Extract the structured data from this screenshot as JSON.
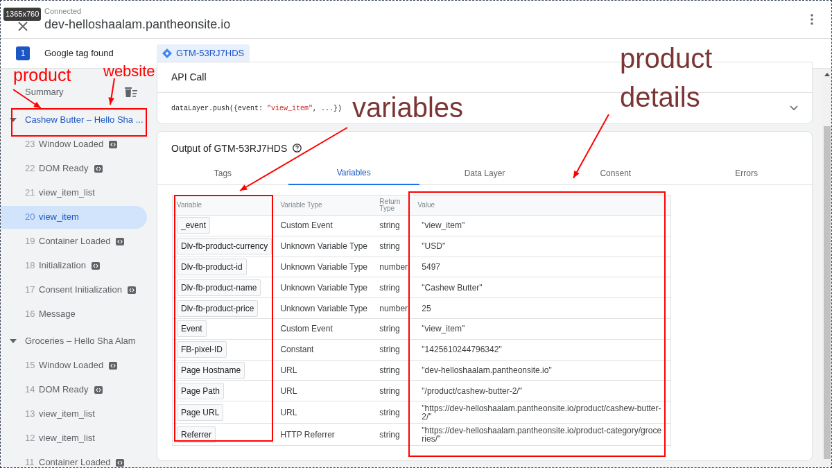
{
  "overlay_badge": "1365x760",
  "header": {
    "status": "Connected",
    "title": "dev-helloshaalam.pantheonsite.io"
  },
  "tag_bar": {
    "count": "1",
    "label": "Google tag found",
    "containers": [
      {
        "label": "GTM-53RJ7HDS",
        "selected": true
      }
    ]
  },
  "sidebar": {
    "summary": "Summary",
    "groups": [
      {
        "title": "Cashew Butter – Hello Sha ...",
        "expanded": true,
        "selected": true,
        "children": [
          {
            "number": "23",
            "name": "Window Loaded",
            "code_badge": true,
            "selected": false
          },
          {
            "number": "22",
            "name": "DOM Ready",
            "code_badge": true,
            "selected": false
          },
          {
            "number": "21",
            "name": "view_item_list",
            "code_badge": false,
            "selected": false
          },
          {
            "number": "20",
            "name": "view_item",
            "code_badge": false,
            "selected": true
          },
          {
            "number": "19",
            "name": "Container Loaded",
            "code_badge": true,
            "selected": false
          },
          {
            "number": "18",
            "name": "Initialization",
            "code_badge": true,
            "selected": false
          },
          {
            "number": "17",
            "name": "Consent Initialization",
            "code_badge": true,
            "selected": false
          },
          {
            "number": "16",
            "name": "Message",
            "code_badge": false,
            "selected": false
          }
        ]
      },
      {
        "title": "Groceries – Hello Sha Alam",
        "expanded": true,
        "selected": false,
        "children": [
          {
            "number": "15",
            "name": "Window Loaded",
            "code_badge": true,
            "selected": false
          },
          {
            "number": "14",
            "name": "DOM Ready",
            "code_badge": true,
            "selected": false
          },
          {
            "number": "13",
            "name": "view_item_list",
            "code_badge": false,
            "selected": false
          },
          {
            "number": "12",
            "name": "view_item_list",
            "code_badge": false,
            "selected": false
          },
          {
            "number": "11",
            "name": "Container Loaded",
            "code_badge": true,
            "selected": false
          }
        ]
      }
    ]
  },
  "api_call": {
    "title": "API Call",
    "code": [
      {
        "kind": "plain",
        "text": "dataLayer.push({event: "
      },
      {
        "kind": "string",
        "text": "\"view_item\""
      },
      {
        "kind": "plain",
        "text": ", ...})"
      }
    ]
  },
  "output": {
    "title": "Output of GTM-53RJ7HDS",
    "tabs": [
      {
        "label": "Tags",
        "selected": false
      },
      {
        "label": "Variables",
        "selected": true
      },
      {
        "label": "Data Layer",
        "selected": false
      },
      {
        "label": "Consent",
        "selected": false
      },
      {
        "label": "Errors",
        "selected": false
      }
    ],
    "table": {
      "columns": [
        "Variable",
        "Variable Type",
        "Return Type",
        "Value"
      ],
      "rows": [
        {
          "variable": "_event",
          "type": "Custom Event",
          "return_type": "string",
          "value": "\"view_item\""
        },
        {
          "variable": "Dlv-fb-product-currency",
          "type": "Unknown Variable Type",
          "return_type": "string",
          "value": "\"USD\""
        },
        {
          "variable": "Dlv-fb-product-id",
          "type": "Unknown Variable Type",
          "return_type": "number",
          "value": "5497"
        },
        {
          "variable": "Dlv-fb-product-name",
          "type": "Unknown Variable Type",
          "return_type": "string",
          "value": "\"Cashew Butter\""
        },
        {
          "variable": "Dlv-fb-product-price",
          "type": "Unknown Variable Type",
          "return_type": "number",
          "value": "25"
        },
        {
          "variable": "Event",
          "type": "Custom Event",
          "return_type": "string",
          "value": "\"view_item\""
        },
        {
          "variable": "FB-pixel-ID",
          "type": "Constant",
          "return_type": "string",
          "value": "\"1425610244796342\""
        },
        {
          "variable": "Page Hostname",
          "type": "URL",
          "return_type": "string",
          "value": "\"dev-helloshaalam.pantheonsite.io\""
        },
        {
          "variable": "Page Path",
          "type": "URL",
          "return_type": "string",
          "value": "\"/product/cashew-butter-2/\""
        },
        {
          "variable": "Page URL",
          "type": "URL",
          "return_type": "string",
          "value": "\"https://dev-helloshaalam.pantheonsite.io/product/cashew-butter-2/\""
        },
        {
          "variable": "Referrer",
          "type": "HTTP Referrer",
          "return_type": "string",
          "value": "\"https://dev-helloshaalam.pantheonsite.io/product-category/groceries/\""
        }
      ]
    }
  },
  "annotations": [
    {
      "text": "product",
      "color": "#ff0000"
    },
    {
      "text": "website",
      "color": "#ff0000"
    },
    {
      "text": "variables",
      "color": "#7b3535"
    },
    {
      "text": "product details",
      "color": "#7b3535"
    }
  ]
}
